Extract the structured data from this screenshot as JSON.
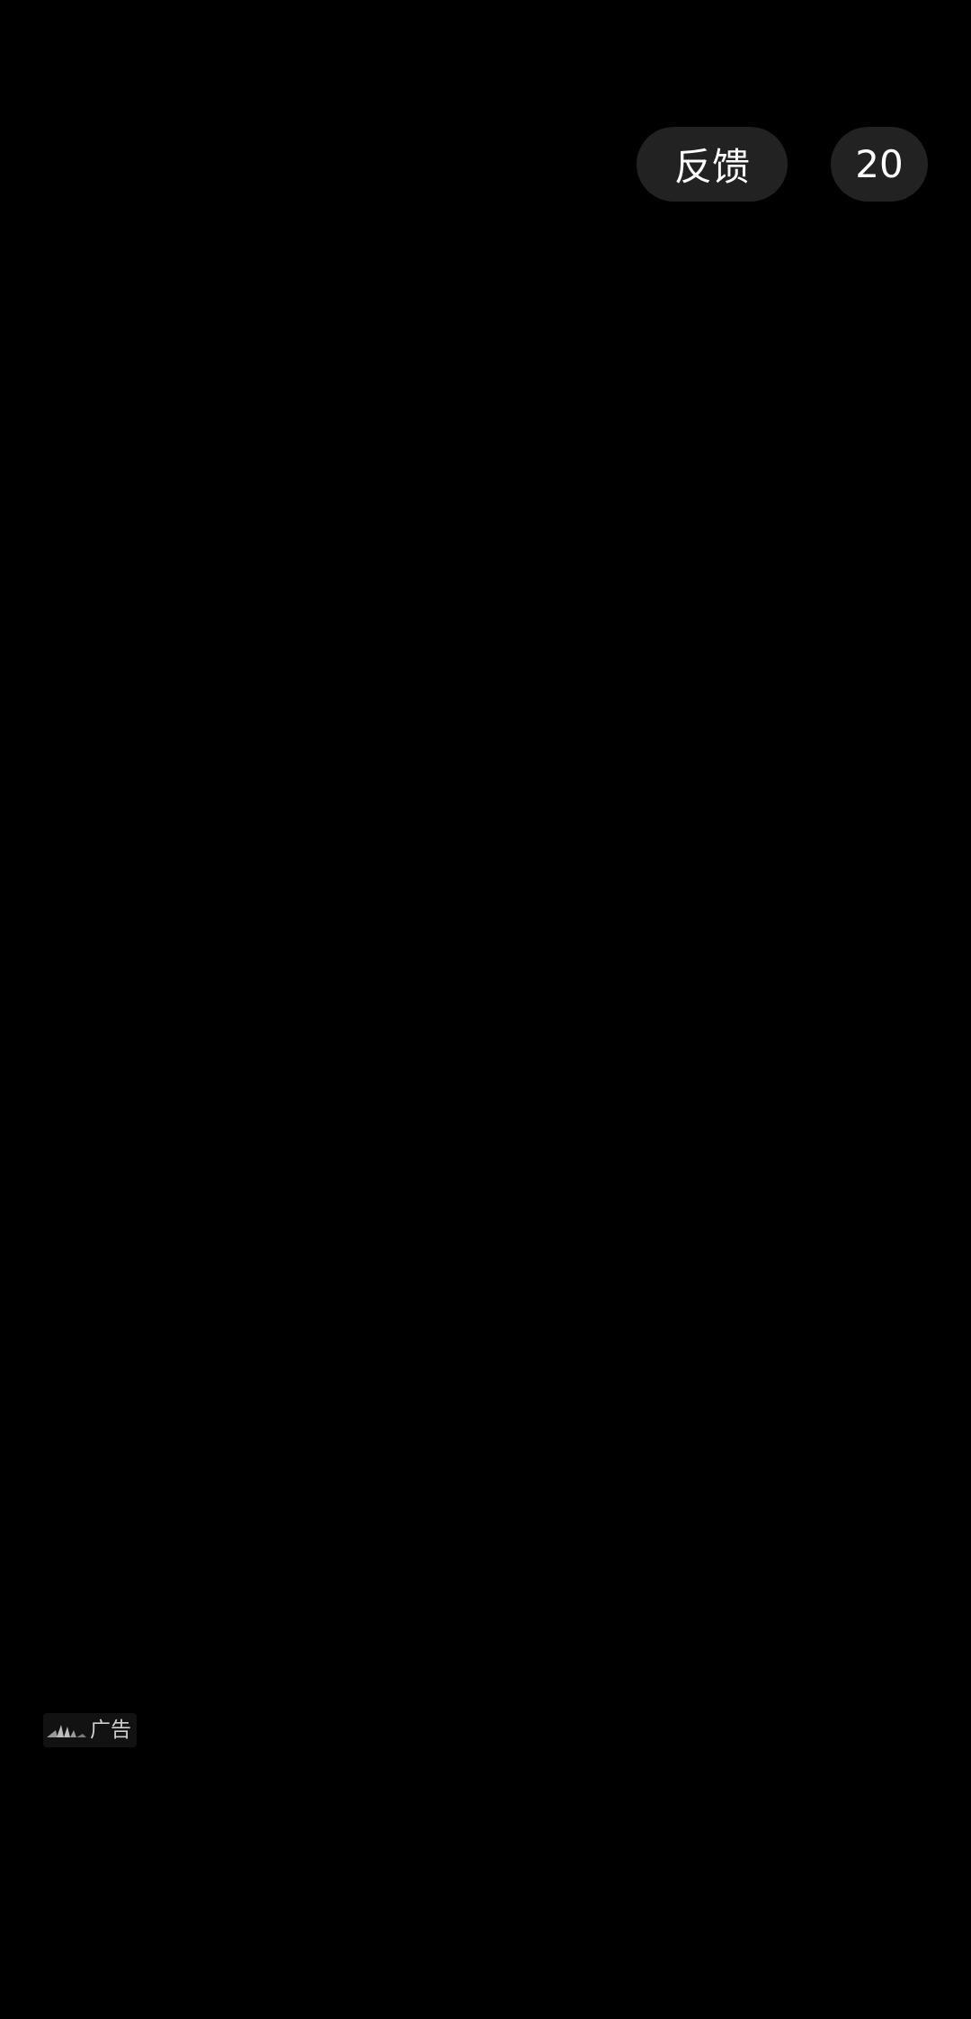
{
  "topbar": {
    "feedback_label": "反馈",
    "countdown_value": "20"
  },
  "ad": {
    "badge_label": "广告",
    "logo_icon": "ad-network-logo-icon"
  },
  "colors": {
    "background": "#000000",
    "pill_background": "#222222",
    "pill_text": "#ffffff",
    "ad_text": "#cfcfcf"
  }
}
